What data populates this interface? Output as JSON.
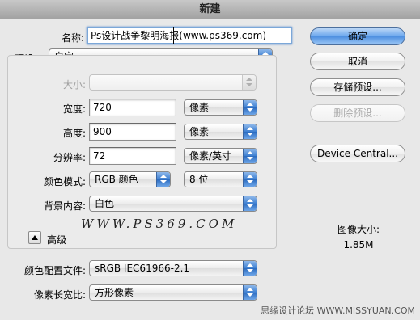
{
  "window": {
    "title": "新建"
  },
  "name_field": {
    "label": "名称:",
    "value": "Ps设计战争黎明海报(www.ps369.com)"
  },
  "preset": {
    "label": "预设:",
    "value": "自定"
  },
  "size": {
    "label": "大小:",
    "value": ""
  },
  "width": {
    "label": "宽度:",
    "value": "720",
    "unit": "像素"
  },
  "height": {
    "label": "高度:",
    "value": "900",
    "unit": "像素"
  },
  "resolution": {
    "label": "分辨率:",
    "value": "72",
    "unit": "像素/英寸"
  },
  "color_mode": {
    "label": "颜色模式:",
    "mode": "RGB 颜色",
    "depth": "8 位"
  },
  "background": {
    "label": "背景内容:",
    "value": "白色"
  },
  "advanced": {
    "label": "高级"
  },
  "color_profile": {
    "label": "颜色配置文件:",
    "value": "sRGB IEC61966-2.1"
  },
  "pixel_aspect": {
    "label": "像素长宽比:",
    "value": "方形像素"
  },
  "buttons": {
    "ok": "确定",
    "cancel": "取消",
    "save_preset": "存储预设...",
    "delete_preset": "删除预设...",
    "device_central": "Device Central..."
  },
  "image_size": {
    "label": "图像大小:",
    "value": "1.85M"
  },
  "watermarks": {
    "center": "WWW.PS369.COM",
    "corner": "思缘设计论坛 WWW.MISSYUAN.COM"
  },
  "colors": {
    "default_button": "#6aa6ec",
    "select_arrow": "#3d7fd1"
  }
}
